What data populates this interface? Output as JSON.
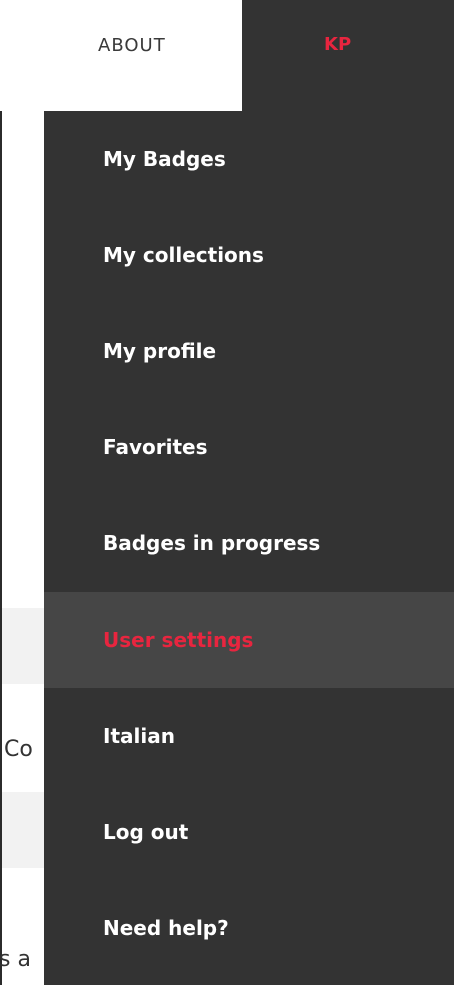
{
  "nav": {
    "about_label": "ABOUT",
    "user_initials": "KP"
  },
  "user_menu": {
    "items": [
      {
        "label": "My Badges"
      },
      {
        "label": "My collections"
      },
      {
        "label": "My profile"
      },
      {
        "label": "Favorites"
      },
      {
        "label": "Badges in progress"
      },
      {
        "label": "User settings",
        "active": true
      },
      {
        "label": "Italian"
      },
      {
        "label": "Log out"
      },
      {
        "label": "Need help?"
      }
    ]
  },
  "background_page": {
    "fragment_1": "Co",
    "fragment_2": "s a"
  },
  "colors": {
    "menu_bg": "#333333",
    "menu_active_bg": "#464646",
    "accent": "#e8253f",
    "text_light": "#ffffff"
  }
}
